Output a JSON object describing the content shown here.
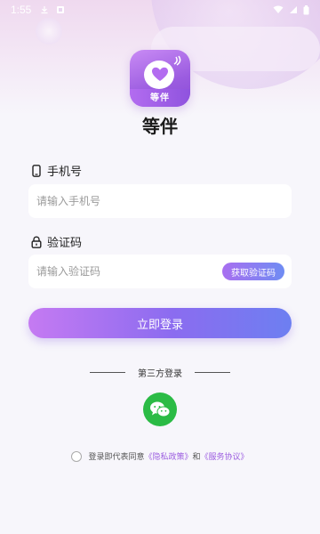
{
  "status_bar": {
    "time": "1:55"
  },
  "app": {
    "icon_text": "等伴",
    "name": "等伴"
  },
  "phone": {
    "label": "手机号",
    "placeholder": "请输入手机号"
  },
  "code": {
    "label": "验证码",
    "placeholder": "请输入验证码",
    "get_code_label": "获取验证码"
  },
  "login_button": "立即登录",
  "third_party": {
    "title": "第三方登录",
    "wechat_icon": "wechat-icon"
  },
  "agreement": {
    "prefix": "登录即代表同意",
    "privacy_link": "《隐私政策》",
    "and": "和",
    "service_link": "《服务协议》"
  },
  "colors": {
    "accent": "#9b5ce0",
    "wechat": "#2bbb45",
    "background": "#f7f6fb"
  }
}
